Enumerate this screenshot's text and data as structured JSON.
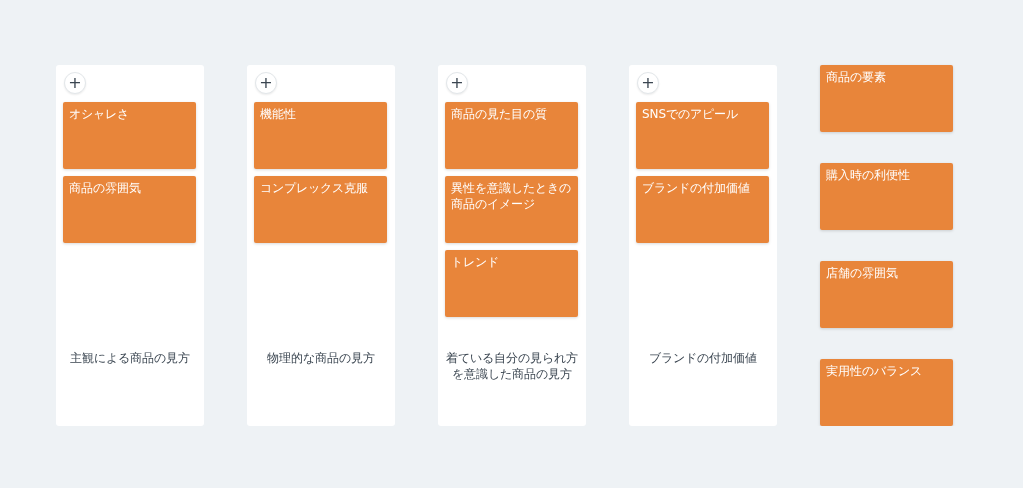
{
  "groups": [
    {
      "add_button": "+",
      "cards": [
        "オシャレさ",
        "商品の雰囲気"
      ],
      "label": "主観による商品の見方"
    },
    {
      "add_button": "+",
      "cards": [
        "機能性",
        "コンプレックス克服"
      ],
      "label": "物理的な商品の見方"
    },
    {
      "add_button": "+",
      "cards": [
        "商品の見た目の質",
        "異性を意識したときの商品のイメージ",
        "トレンド"
      ],
      "label": "着ている自分の見られ方を意識した商品の見方"
    },
    {
      "add_button": "+",
      "cards": [
        "SNSでのアピール",
        "ブランドの付加価値"
      ],
      "label": "ブランドの付加価値"
    }
  ],
  "loose_cards": [
    "商品の要素",
    "購入時の利便性",
    "店舗の雰囲気",
    "実用性のバランス"
  ]
}
